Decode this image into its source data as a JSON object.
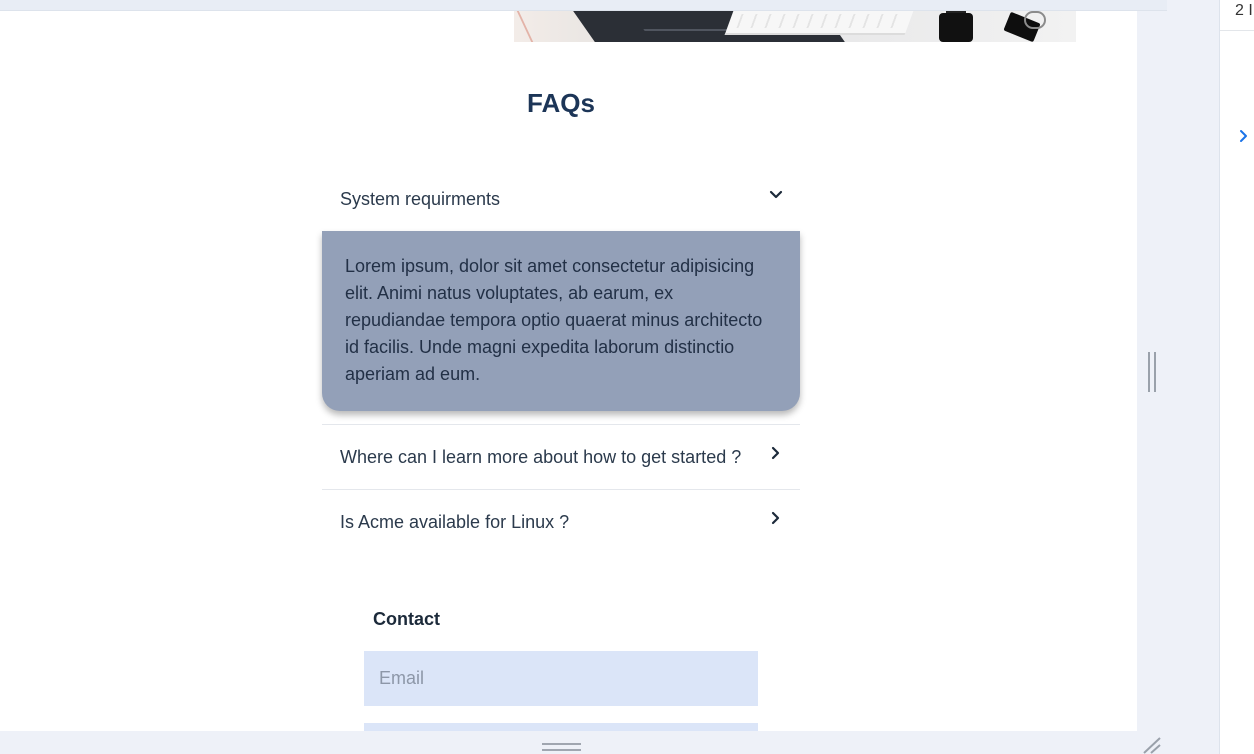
{
  "faq": {
    "title": "FAQs",
    "items": [
      {
        "question": "System requirments",
        "expanded": true,
        "answer": "Lorem ipsum, dolor sit amet consectetur adipisicing elit. Animi natus voluptates, ab earum, ex repudiandae tempora optio quaerat minus architecto id facilis. Unde magni expedita laborum distinctio aperiam ad eum."
      },
      {
        "question": "Where can I learn more about how to get started ?",
        "expanded": false
      },
      {
        "question": "Is Acme available for Linux ?",
        "expanded": false
      }
    ]
  },
  "contact": {
    "title": "Contact",
    "email_placeholder": "Email"
  },
  "side_panel": {
    "count_text": "2 I",
    "expand_icon": "chevron-right-icon"
  },
  "colors": {
    "heading": "#1c3557",
    "answer_bg": "#93a0b8",
    "input_bg": "#dbe5f8",
    "accent": "#1a73e8"
  }
}
